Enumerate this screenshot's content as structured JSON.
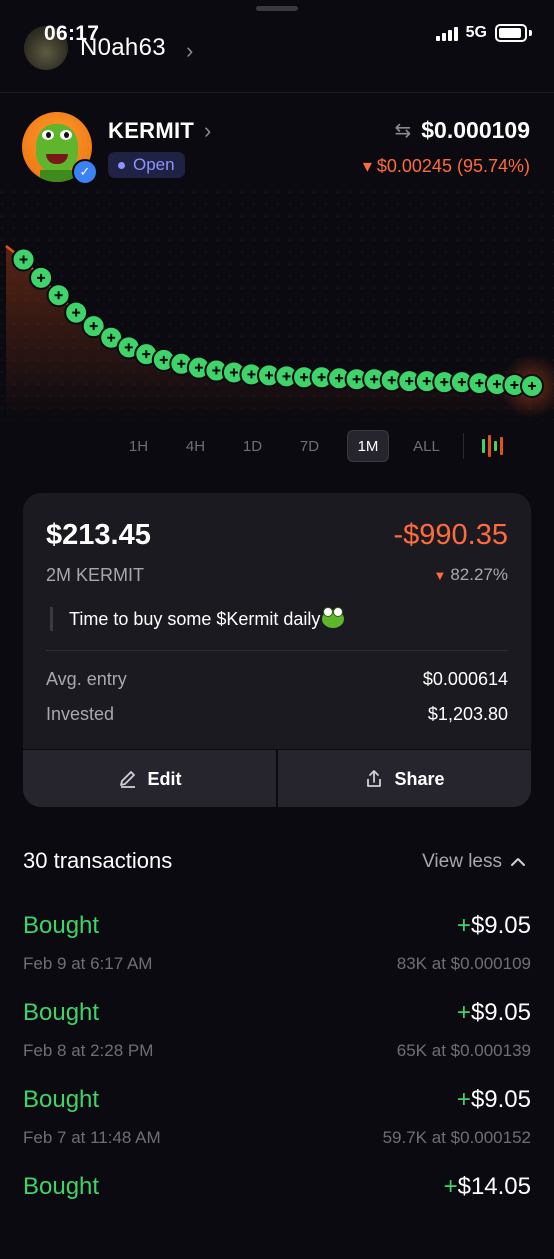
{
  "status_bar": {
    "time": "06:17",
    "network": "5G"
  },
  "account": {
    "username": "N0ah63"
  },
  "token": {
    "name": "KERMIT",
    "status": "Open",
    "price": "$0.000109",
    "change": "▾ $0.00245 (95.74%)"
  },
  "chart_data": {
    "type": "line",
    "title": "",
    "xlabel": "",
    "ylabel": "",
    "x": [
      0,
      1,
      2,
      3,
      4,
      5,
      6,
      7,
      8,
      9,
      10,
      11,
      12,
      13,
      14,
      15,
      16,
      17,
      18,
      19,
      20,
      21,
      22,
      23,
      24,
      25,
      26,
      27,
      28,
      29,
      30
    ],
    "series": [
      {
        "values": [
          0.00255,
          0.00241,
          0.00222,
          0.00204,
          0.00186,
          0.00172,
          0.0016,
          0.0015,
          0.00143,
          0.00137,
          0.00133,
          0.00129,
          0.00126,
          0.00124,
          0.00122,
          0.00121,
          0.0012,
          0.00119,
          0.00119,
          0.00118,
          0.00117,
          0.00117,
          0.00116,
          0.00115,
          0.00115,
          0.00114,
          0.00114,
          0.00113,
          0.00112,
          0.00111,
          0.0011
        ]
      }
    ],
    "buy_markers": [
      1,
      2,
      3,
      4,
      5,
      6,
      7,
      8,
      9,
      10,
      11,
      12,
      13,
      14,
      15,
      16,
      17,
      18,
      19,
      20,
      21,
      22,
      23,
      24,
      25,
      26,
      27,
      28,
      29,
      30
    ],
    "grid": false,
    "line_color": "#e0541c"
  },
  "timeframes": [
    "1H",
    "4H",
    "1D",
    "7D",
    "1M",
    "ALL"
  ],
  "active_timeframe": "1M",
  "position": {
    "value": "$213.45",
    "pnl": "-$990.35",
    "holding": "2M KERMIT",
    "pnl_pct": "82.27%",
    "note": "Time to buy some $Kermit daily",
    "avg_entry_label": "Avg. entry",
    "avg_entry": "$0.000614",
    "invested_label": "Invested",
    "invested": "$1,203.80",
    "edit_label": "Edit",
    "share_label": "Share"
  },
  "transactions": {
    "title": "30 transactions",
    "toggle_label": "View less",
    "items": [
      {
        "type": "Bought",
        "amount": "$9.05",
        "date": "Feb 9 at 6:17 AM",
        "detail": "83K at $0.000109"
      },
      {
        "type": "Bought",
        "amount": "$9.05",
        "date": "Feb 8 at 2:28 PM",
        "detail": "65K at $0.000139"
      },
      {
        "type": "Bought",
        "amount": "$9.05",
        "date": "Feb 7 at 11:48 AM",
        "detail": "59.7K at $0.000152"
      },
      {
        "type": "Bought",
        "amount": "$14.05",
        "date": "",
        "detail": ""
      }
    ]
  },
  "colors": {
    "positive": "#3fd46a",
    "negative": "#ff6b3d",
    "accent": "#8b93ff",
    "background": "#0b0a10"
  }
}
